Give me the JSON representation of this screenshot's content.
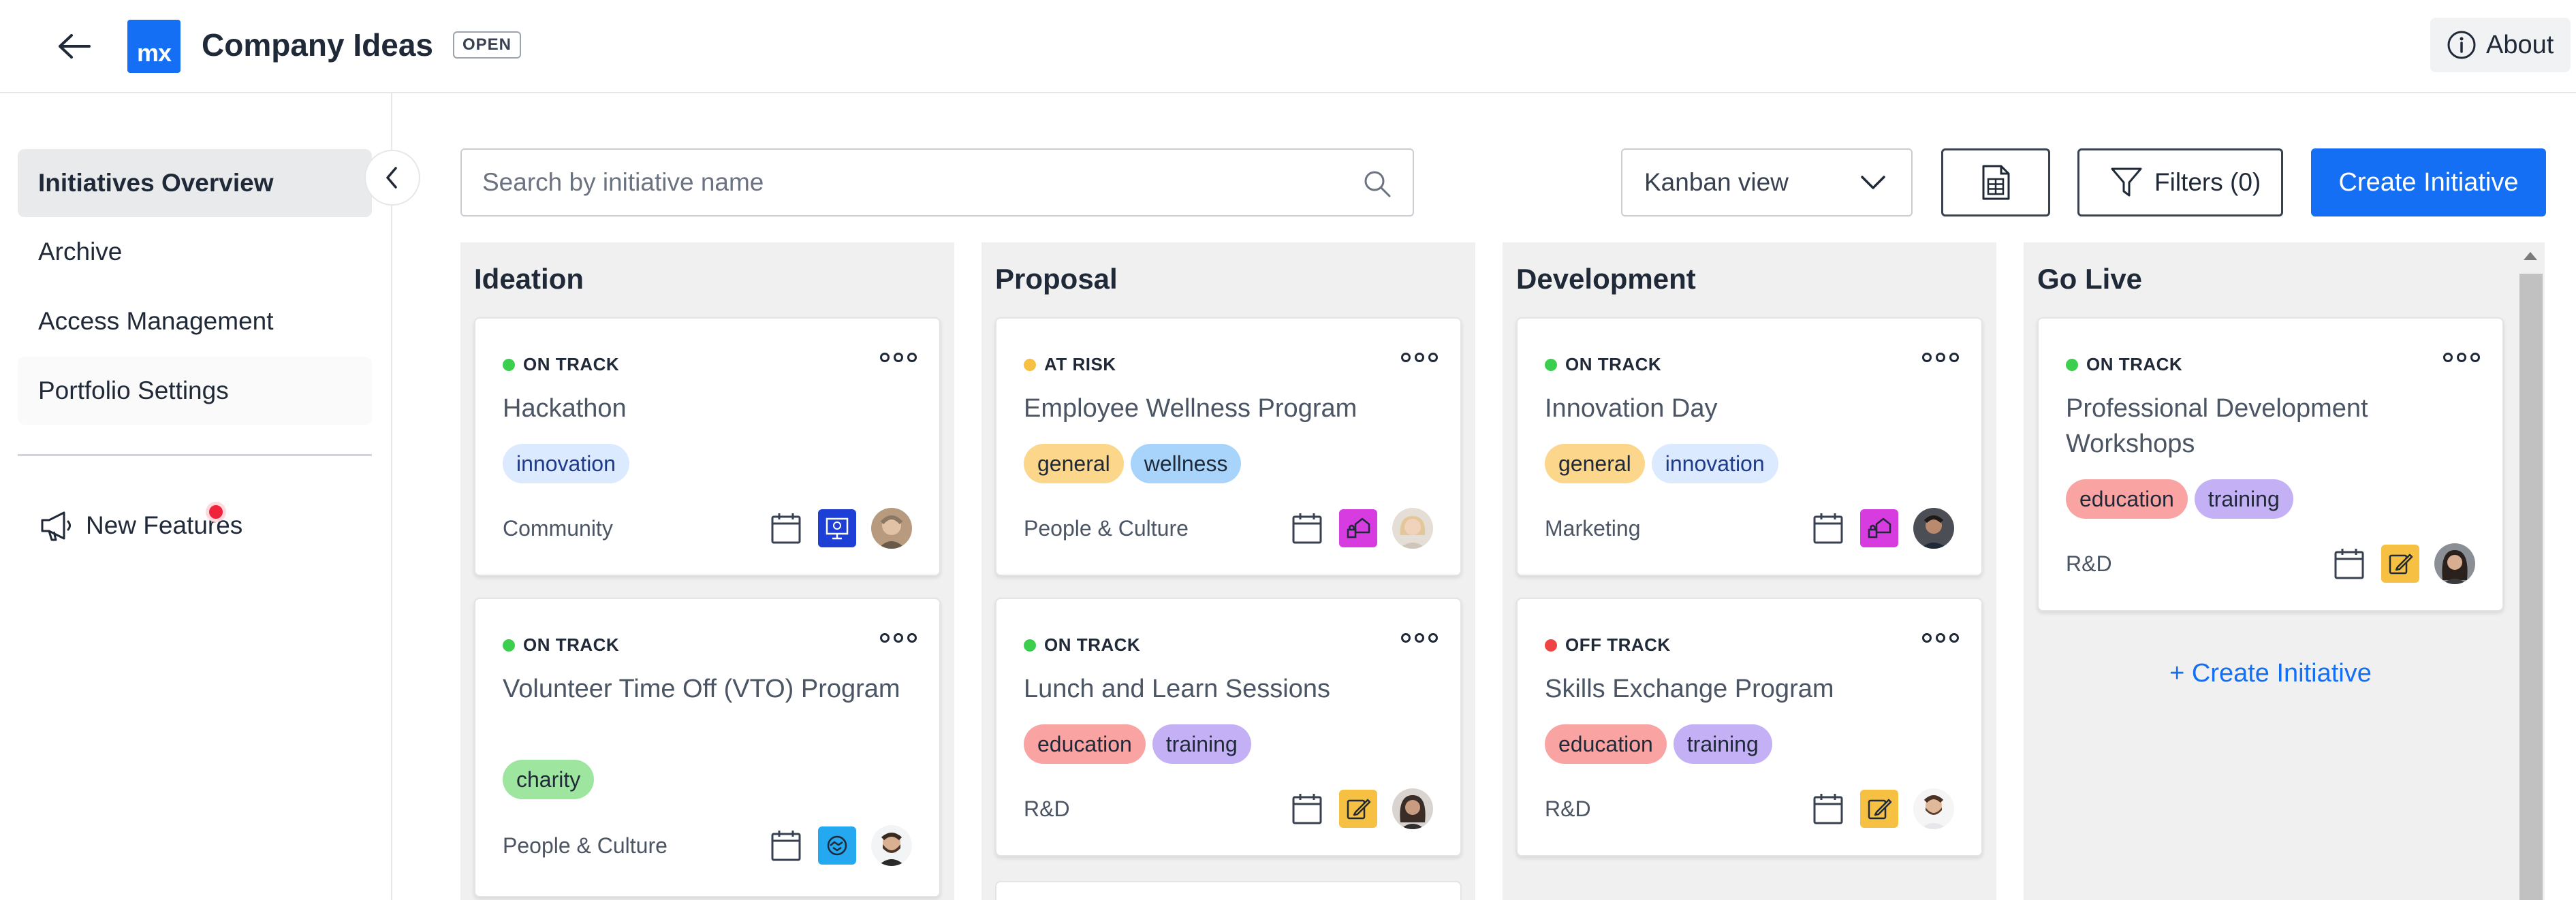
{
  "header": {
    "title": "Company Ideas",
    "badge": "OPEN",
    "logo_text": "mx",
    "about_label": "About"
  },
  "sidebar": {
    "items": [
      {
        "label": "Initiatives Overview",
        "active": true
      },
      {
        "label": "Archive"
      },
      {
        "label": "Access Management"
      },
      {
        "label": "Portfolio Settings"
      }
    ],
    "new_features_label": "New Features"
  },
  "toolbar": {
    "search_placeholder": "Search by initiative name",
    "view_label": "Kanban view",
    "filters_label": "Filters (0)",
    "create_label": "Create Initiative"
  },
  "colors": {
    "primary": "#146ff4",
    "on_track": "#3ccf4e",
    "at_risk": "#f6c142",
    "off_track": "#ef4444"
  },
  "board": {
    "columns": [
      {
        "title": "Ideation",
        "cards": [
          {
            "status": "ON TRACK",
            "title": "Hackathon",
            "tags": [
              "innovation"
            ],
            "department": "Community",
            "category_icon": "presentation-icon",
            "avatar": "avatar-man-glasses"
          },
          {
            "status": "ON TRACK",
            "title": "Volunteer Time Off (VTO) Program",
            "tags": [
              "charity"
            ],
            "department": "People & Culture",
            "category_icon": "handshake-icon",
            "avatar": "avatar-man-beard"
          }
        ]
      },
      {
        "title": "Proposal",
        "cards": [
          {
            "status": "AT RISK",
            "title": "Employee Wellness Program",
            "tags": [
              "general",
              "wellness"
            ],
            "department": "People & Culture",
            "category_icon": "home-lock-icon",
            "avatar": "avatar-woman-blonde"
          },
          {
            "status": "ON TRACK",
            "title": "Lunch and Learn Sessions",
            "tags": [
              "education",
              "training"
            ],
            "department": "R&D",
            "category_icon": "edit-icon",
            "avatar": "avatar-woman-dark"
          }
        ]
      },
      {
        "title": "Development",
        "cards": [
          {
            "status": "ON TRACK",
            "title": "Innovation Day",
            "tags": [
              "general",
              "innovation"
            ],
            "department": "Marketing",
            "category_icon": "home-lock-icon",
            "avatar": "avatar-man-dark"
          },
          {
            "status": "OFF TRACK",
            "title": "Skills Exchange Program",
            "tags": [
              "education",
              "training"
            ],
            "department": "R&D",
            "category_icon": "edit-icon",
            "avatar": "avatar-man-beard-2"
          }
        ]
      },
      {
        "title": "Go Live",
        "cards": [
          {
            "status": "ON TRACK",
            "title": "Professional Development Workshops",
            "tags": [
              "education",
              "training"
            ],
            "department": "R&D",
            "category_icon": "edit-icon",
            "avatar": "avatar-woman-long-hair"
          }
        ],
        "add_label": "+ Create Initiative"
      }
    ]
  }
}
